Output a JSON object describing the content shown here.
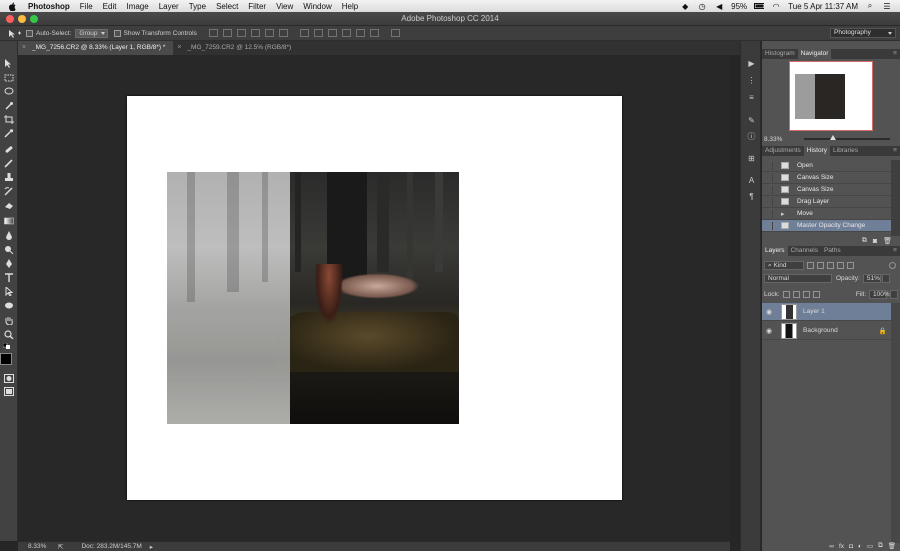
{
  "menubar": {
    "items": [
      "Photoshop",
      "File",
      "Edit",
      "Image",
      "Layer",
      "Type",
      "Select",
      "Filter",
      "View",
      "Window",
      "Help"
    ],
    "battery": "95%",
    "datetime": "Tue 5 Apr  11:37 AM"
  },
  "window": {
    "title": "Adobe Photoshop CC 2014"
  },
  "options": {
    "auto_select_label": "Auto-Select:",
    "auto_select_value": "Group",
    "show_transform_label": "Show Transform Controls",
    "workspace": "Photography"
  },
  "tabs": [
    {
      "label": "_MG_7256.CR2 @ 8.33% (Layer 1, RGB/8*) *",
      "active": true
    },
    {
      "label": "_MG_7259.CR2 @ 12.5% (RGB/8*)",
      "active": false
    }
  ],
  "status": {
    "zoom": "8.33%",
    "doc": "Doc: 283.2M/145.7M"
  },
  "navigator": {
    "tabs": [
      "Histogram",
      "Navigator"
    ],
    "zoom": "8.33%"
  },
  "history": {
    "tabs": [
      "Adjustments",
      "History",
      "Libraries"
    ],
    "items": [
      "Open",
      "Canvas Size",
      "Canvas Size",
      "Drag Layer",
      "Move",
      "Master Opacity Change"
    ],
    "selected_index": 5
  },
  "layers": {
    "tabs": [
      "Layers",
      "Channels",
      "Paths"
    ],
    "filter": "Kind",
    "blend_mode": "Normal",
    "opacity_label": "Opacity:",
    "opacity": "51%",
    "lock_label": "Lock:",
    "fill_label": "Fill:",
    "fill": "100%",
    "items": [
      {
        "name": "Layer 1",
        "selected": true
      },
      {
        "name": "Background",
        "selected": false
      }
    ]
  },
  "colors": {
    "selection": "#6f7f98",
    "accent_red": "#d56a6a"
  }
}
